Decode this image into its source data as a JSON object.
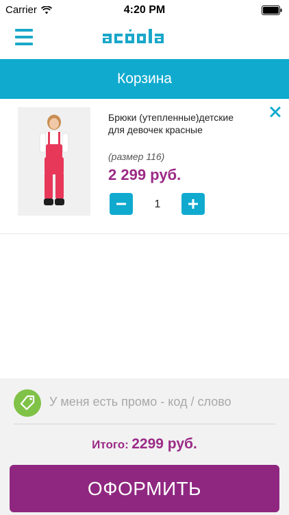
{
  "status_bar": {
    "carrier": "Carrier",
    "time": "4:20 PM"
  },
  "header": {
    "logo_text": "acoola",
    "brand_color": "#1aa7c9"
  },
  "title_bar": {
    "title": "Корзина"
  },
  "cart": {
    "items": [
      {
        "name": "Брюки (утепленные)детские для девочек красные",
        "size": "(размер 116)",
        "price": "2 299 руб.",
        "quantity": "1"
      }
    ]
  },
  "promo": {
    "placeholder": "У меня есть промо - код / слово",
    "value": ""
  },
  "total": {
    "label": "Итого:",
    "value": "2299 руб."
  },
  "checkout": {
    "label": "ОФОРМИТЬ"
  },
  "colors": {
    "accent": "#10aacf",
    "price": "#9b2a86",
    "checkout": "#8f2781",
    "promo_icon": "#7fc247"
  },
  "icons": [
    "wifi-icon",
    "battery-icon",
    "menu-icon",
    "close-icon",
    "minus-icon",
    "plus-icon",
    "tag-icon"
  ]
}
